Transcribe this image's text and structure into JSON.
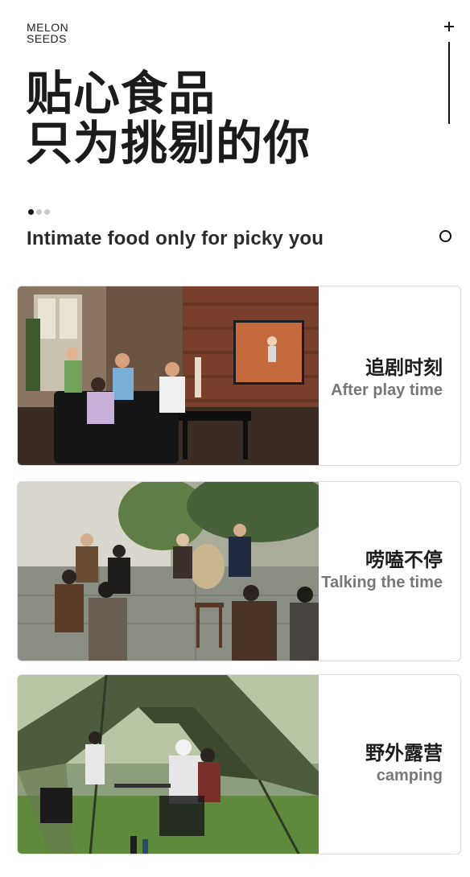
{
  "brand": {
    "line1": "MELON",
    "line2": "SEEDS"
  },
  "headline": {
    "line1": "贴心食品",
    "line2": "只为挑剔的你"
  },
  "pager": {
    "count": 3,
    "active": 1
  },
  "subtitle": "Intimate food only for picky you",
  "icons": {
    "top_right": "plus-icon",
    "subtitle_right": "circle-icon"
  },
  "cards": [
    {
      "cn": "追剧时刻",
      "en": "After play time",
      "image": "family-watching-tennis-on-tv"
    },
    {
      "cn": "唠嗑不停",
      "en": "Talking the time",
      "image": "group-chatting-in-courtyard"
    },
    {
      "cn": "野外露营",
      "en": "camping",
      "image": "camping-under-tent"
    }
  ]
}
